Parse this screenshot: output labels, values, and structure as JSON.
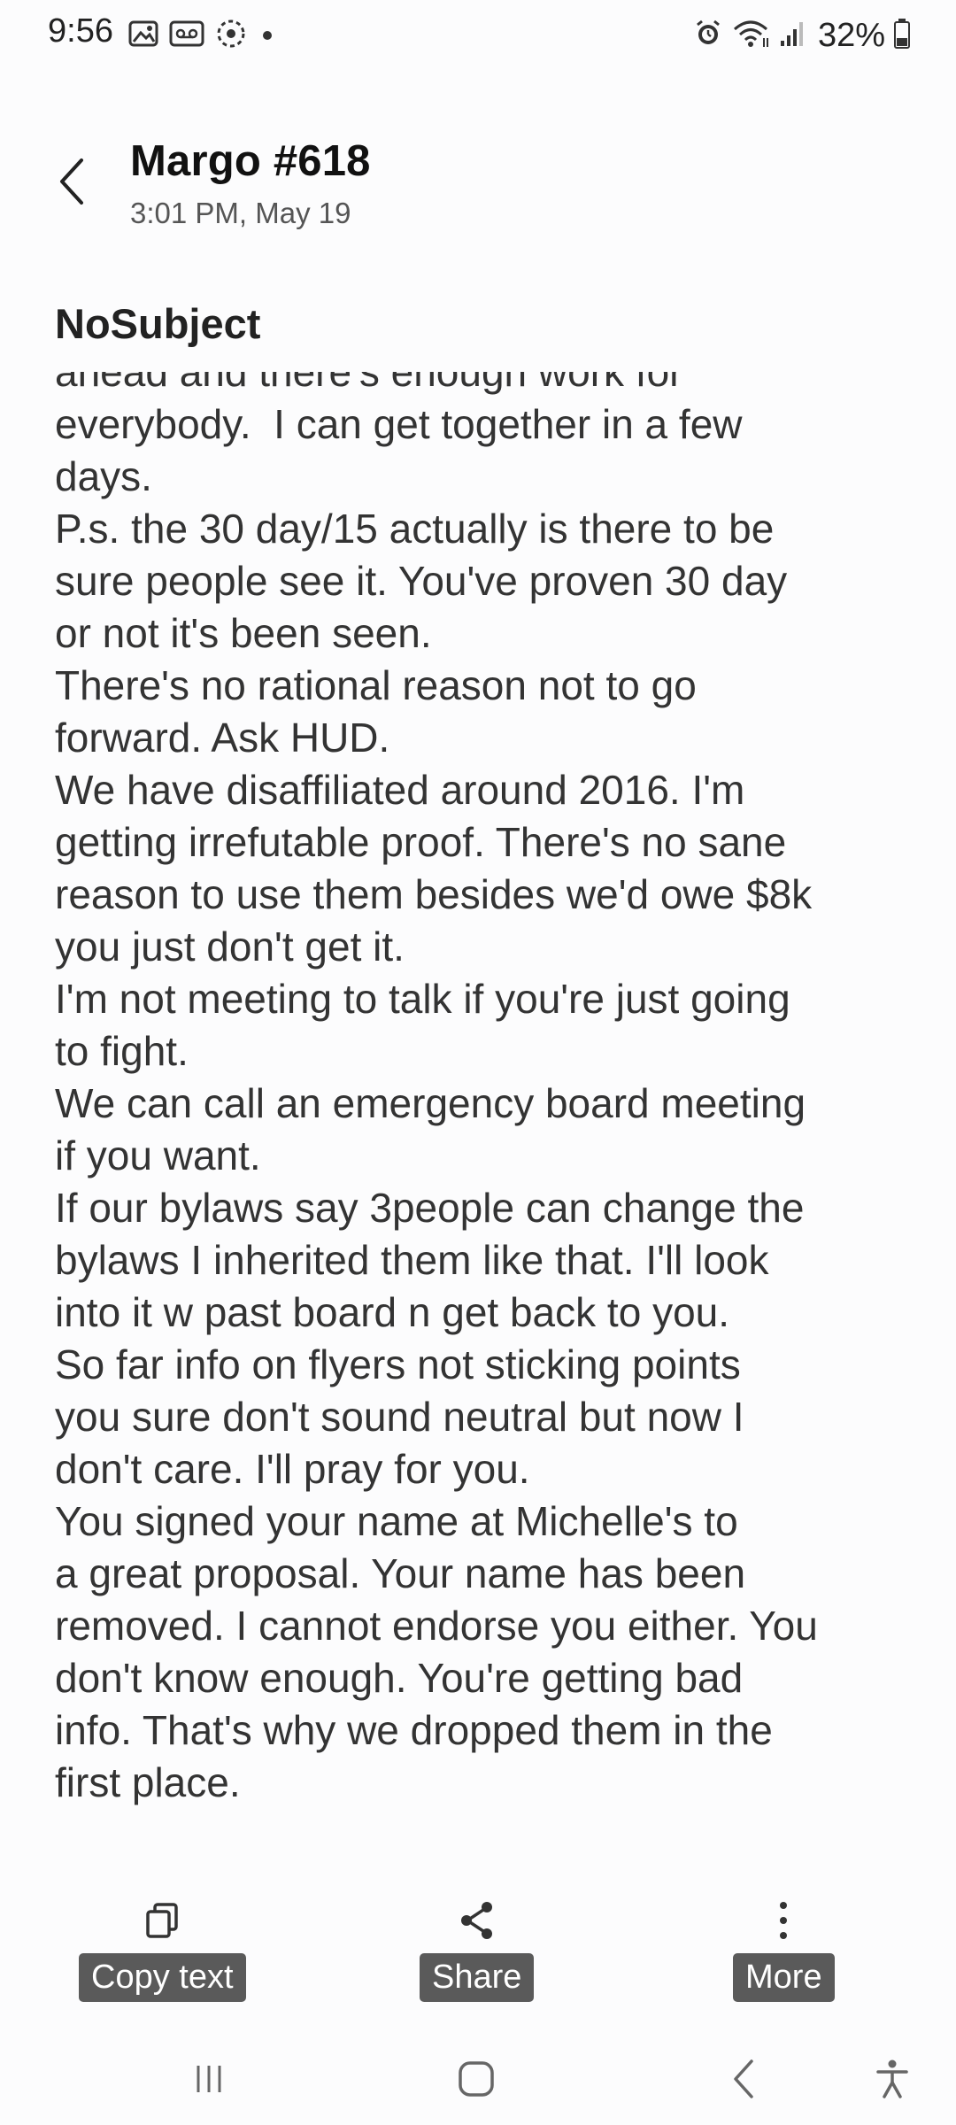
{
  "status_bar": {
    "time": "9:56",
    "battery": "32%",
    "left_icons": [
      "image-icon",
      "voicemail-icon",
      "sync-icon",
      "notification-dot"
    ],
    "right_icons": [
      "alarm-icon",
      "wifi-icon",
      "signal-icon",
      "battery-icon"
    ]
  },
  "header": {
    "title": "Margo #618",
    "subtitle": "3:01 PM, May 19"
  },
  "message": {
    "subject": "NoSubject",
    "body": "ahead and there's enough work for\neverybody.  I can get together in a few\ndays.\nP.s. the 30 day/15 actually is there to be\nsure people see it. You've proven 30 day\nor not it's been seen.\nThere's no rational reason not to go\nforward. Ask HUD.\nWe have disaffiliated around 2016. I'm\ngetting irrefutable proof. There's no sane\nreason to use them besides we'd owe $8k\nyou just don't get it.\nI'm not meeting to talk if you're just going\nto fight.\nWe can call an emergency board meeting\nif you want.\nIf our bylaws say 3people can change the\nbylaws I inherited them like that. I'll look\ninto it w past board n get back to you.\nSo far info on flyers not sticking points\nyou sure don't sound neutral but now I\ndon't care. I'll pray for you.\nYou signed your name at Michelle's to\na great proposal. Your name has been\nremoved. I cannot endorse you either. You\ndon't know enough. You're getting bad\ninfo. That's why we dropped them in the\nfirst place."
  },
  "actions": {
    "copy_label": "Copy text",
    "share_label": "Share",
    "more_label": "More"
  },
  "nav": {
    "icons": [
      "recents-icon",
      "home-icon",
      "back-icon",
      "accessibility-icon"
    ]
  }
}
